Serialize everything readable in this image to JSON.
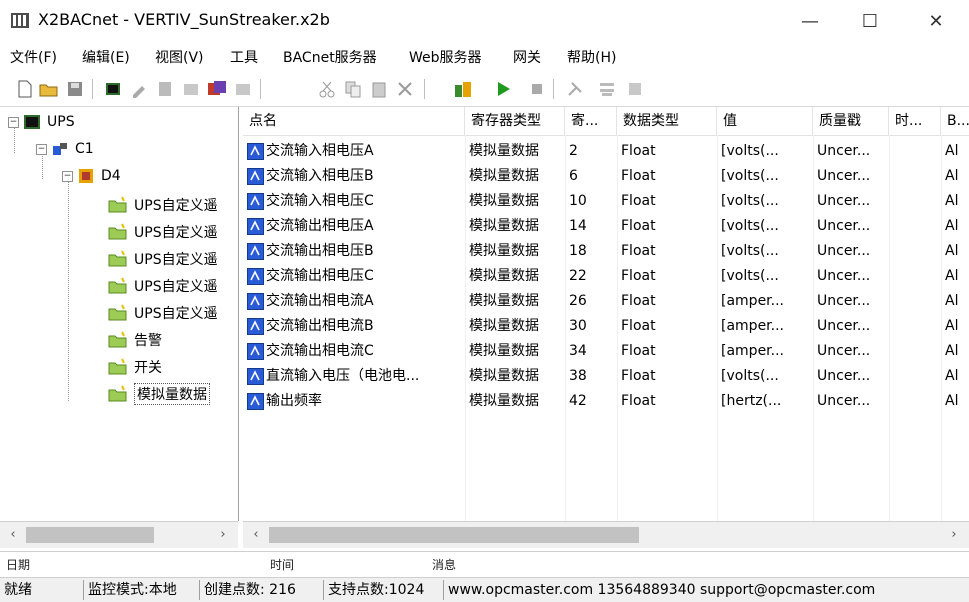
{
  "window": {
    "title": "X2BACnet - VERTIV_SunStreaker.x2b",
    "minimize": "—",
    "maximize": "☐",
    "close": "✕"
  },
  "menu": [
    "文件(F)",
    "编辑(E)",
    "视图(V)",
    "工具",
    "BACnet服务器",
    "Web服务器",
    "网关",
    "帮助(H)"
  ],
  "toolbar_icons": [
    "new-file-icon",
    "open-folder-icon",
    "save-icon",
    "device-icon",
    "edit-icon",
    "properties-icon",
    "settings-icon",
    "bacnet-op-icon",
    "export-icon",
    "cut-icon",
    "copy-icon",
    "paste-icon",
    "delete-icon",
    "user-config-icon",
    "run-icon",
    "stop-icon",
    "tools-icon",
    "network-icon",
    "gateway-icon"
  ],
  "tree": {
    "root": "UPS",
    "channel": "C1",
    "device": "D4",
    "groups": [
      "UPS自定义遥",
      "UPS自定义遥",
      "UPS自定义遥",
      "UPS自定义遥",
      "UPS自定义遥",
      "告警",
      "开关",
      "模拟量数据"
    ]
  },
  "table": {
    "columns": [
      "点名",
      "寄存器类型",
      "寄...",
      "数据类型",
      "值",
      "质量戳",
      "时...",
      "B..."
    ],
    "rows": [
      [
        "交流输入相电压A",
        "模拟量数据",
        "2",
        "Float",
        "[volts(...",
        "Uncer...",
        "",
        "Al"
      ],
      [
        "交流输入相电压B",
        "模拟量数据",
        "6",
        "Float",
        "[volts(...",
        "Uncer...",
        "",
        "Al"
      ],
      [
        "交流输入相电压C",
        "模拟量数据",
        "10",
        "Float",
        "[volts(...",
        "Uncer...",
        "",
        "Al"
      ],
      [
        "交流输出相电压A",
        "模拟量数据",
        "14",
        "Float",
        "[volts(...",
        "Uncer...",
        "",
        "Al"
      ],
      [
        "交流输出相电压B",
        "模拟量数据",
        "18",
        "Float",
        "[volts(...",
        "Uncer...",
        "",
        "Al"
      ],
      [
        "交流输出相电压C",
        "模拟量数据",
        "22",
        "Float",
        "[volts(...",
        "Uncer...",
        "",
        "Al"
      ],
      [
        "交流输出相电流A",
        "模拟量数据",
        "26",
        "Float",
        "[amper...",
        "Uncer...",
        "",
        "Al"
      ],
      [
        "交流输出相电流B",
        "模拟量数据",
        "30",
        "Float",
        "[amper...",
        "Uncer...",
        "",
        "Al"
      ],
      [
        "交流输出相电流C",
        "模拟量数据",
        "34",
        "Float",
        "[amper...",
        "Uncer...",
        "",
        "Al"
      ],
      [
        "直流输入电压（电池电...",
        "模拟量数据",
        "38",
        "Float",
        "[volts(...",
        "Uncer...",
        "",
        "Al"
      ],
      [
        "输出频率",
        "模拟量数据",
        "42",
        "Float",
        "[hertz(...",
        "Uncer...",
        "",
        "Al"
      ]
    ]
  },
  "scroll": {
    "left": "‹",
    "right": "›"
  },
  "log_headers": [
    "日期",
    "时间",
    "消息"
  ],
  "status": [
    "就绪",
    "监控模式:本地",
    "创建点数: 216",
    "支持点数:1024",
    "www.opcmaster.com 13564889340 support@opcmaster.com"
  ],
  "colors": {
    "accent": "#2a5bd7",
    "icon_green": "#3c8a2e",
    "icon_yellow": "#e6c100"
  }
}
